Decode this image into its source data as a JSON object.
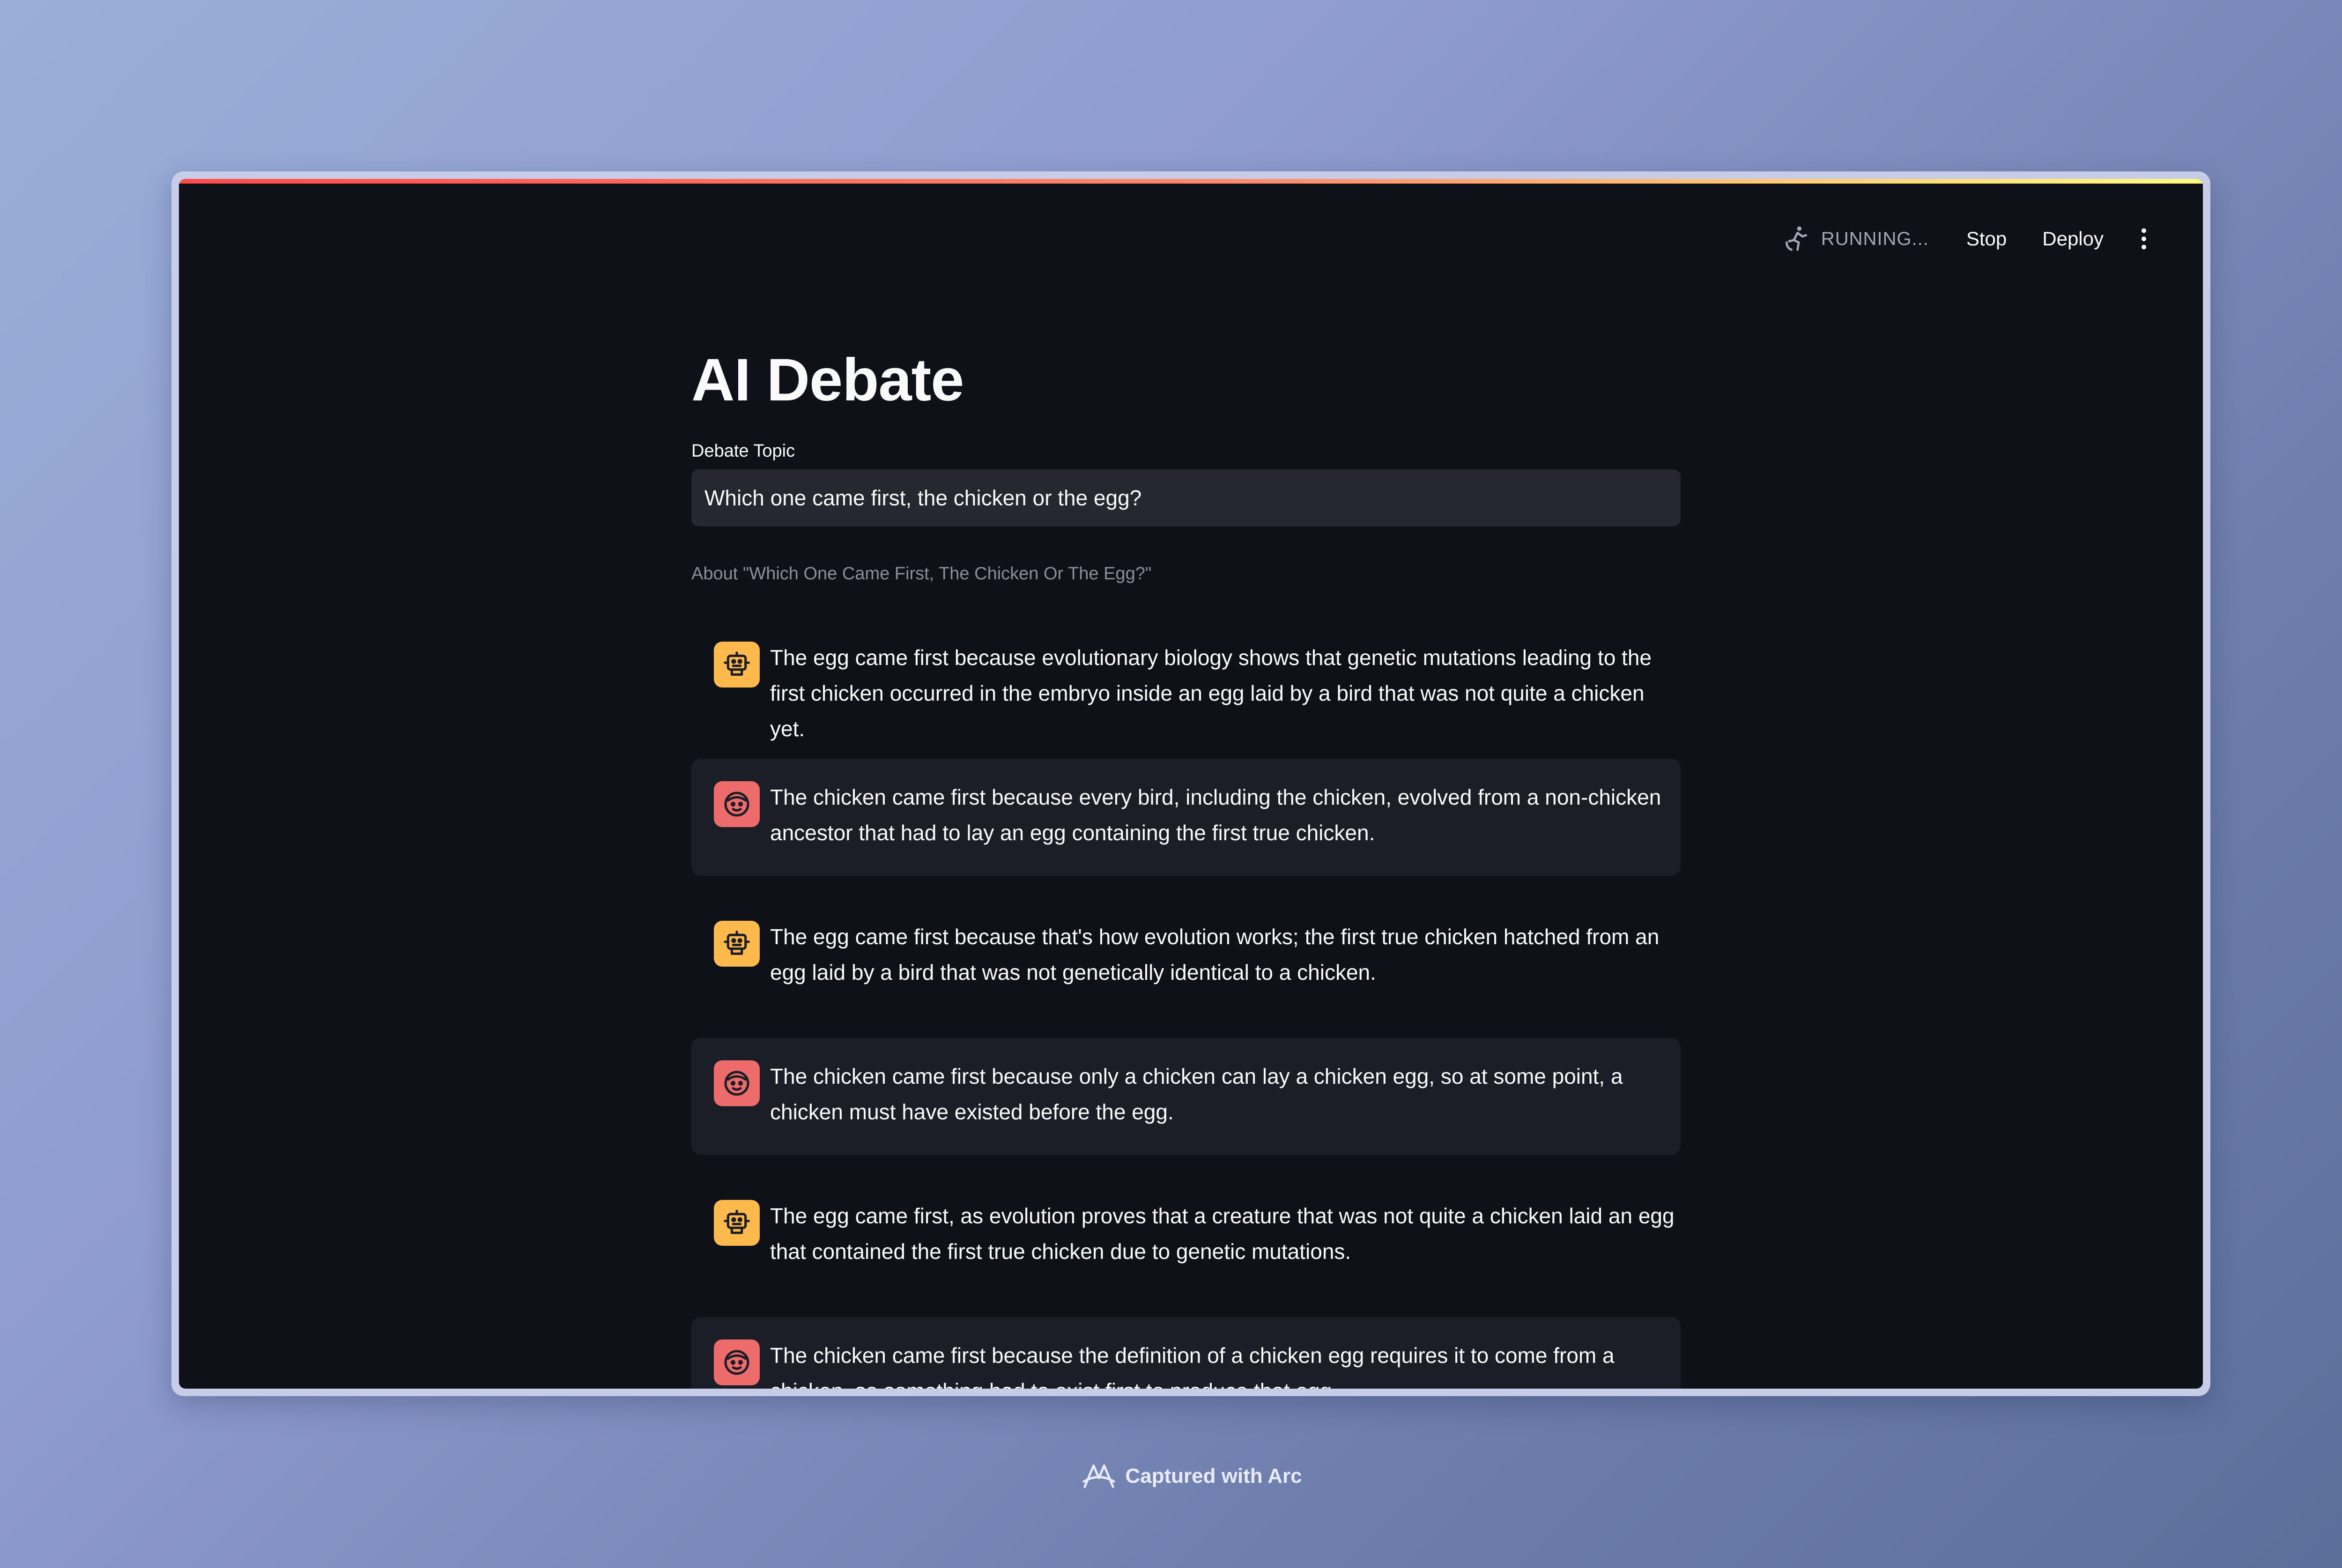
{
  "header": {
    "status_text": "RUNNING...",
    "stop_label": "Stop",
    "deploy_label": "Deploy"
  },
  "main": {
    "title": "AI Debate",
    "topic_label": "Debate Topic",
    "topic_value": "Which one came first, the chicken or the egg?",
    "caption": "About \"Which One Came First, The Chicken Or The Egg?\""
  },
  "messages": [
    {
      "role": "assistant",
      "avatar_icon": "robot-icon",
      "text": "The egg came first because evolutionary biology shows that genetic mutations leading to the first chicken occurred in the embryo inside an egg laid by a bird that was not quite a chicken yet."
    },
    {
      "role": "user",
      "avatar_icon": "face-icon",
      "text": "The chicken came first because every bird, including the chicken, evolved from a non-chicken ancestor that had to lay an egg containing the first true chicken."
    },
    {
      "role": "assistant",
      "avatar_icon": "robot-icon",
      "text": "The egg came first because that's how evolution works; the first true chicken hatched from an egg laid by a bird that was not genetically identical to a chicken."
    },
    {
      "role": "user",
      "avatar_icon": "face-icon",
      "text": "The chicken came first because only a chicken can lay a chicken egg, so at some point, a chicken must have existed before the egg."
    },
    {
      "role": "assistant",
      "avatar_icon": "robot-icon",
      "text": "The egg came first, as evolution proves that a creature that was not quite a chicken laid an egg that contained the first true chicken due to genetic mutations."
    },
    {
      "role": "user",
      "avatar_icon": "face-icon",
      "text": "The chicken came first because the definition of a chicken egg requires it to come from a chicken, so something had to exist first to produce that egg."
    }
  ],
  "footer": {
    "text": "Captured with Arc"
  },
  "colors": {
    "app_background": "#0e1117",
    "input_background": "#262730",
    "shaded_message": "#1b1e27",
    "bot_avatar": "#fdb94c",
    "user_avatar": "#ee6b6b"
  }
}
